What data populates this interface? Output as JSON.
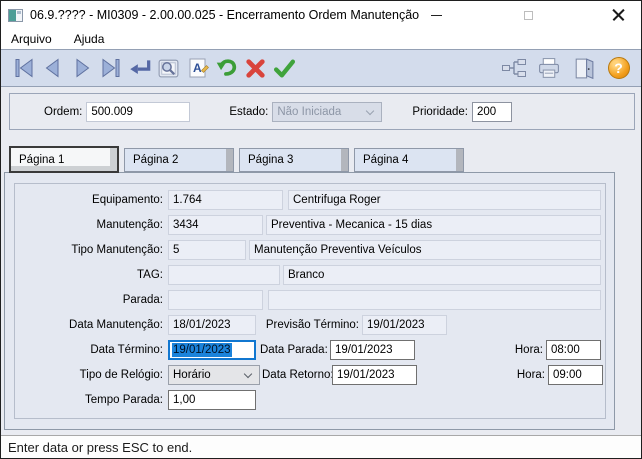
{
  "window": {
    "title": "06.9.???? - MI0309 - 2.00.00.025 - Encerramento Ordem Manutenção"
  },
  "menu": {
    "items": [
      "Arquivo",
      "Ajuda"
    ]
  },
  "toolbar": {
    "left_icons": [
      "nav-first",
      "nav-prev",
      "nav-next",
      "nav-last",
      "enter",
      "preview",
      "font",
      "undo",
      "cancel",
      "confirm"
    ],
    "right_icons": [
      "hierarchy",
      "print",
      "exit",
      "help"
    ]
  },
  "icons": {
    "help_glyph": "?"
  },
  "header": {
    "ordem": {
      "label": "Ordem:",
      "value": "500.009"
    },
    "estado": {
      "label": "Estado:",
      "value": "Não Iniciada"
    },
    "prioridade": {
      "label": "Prioridade:",
      "value": "200"
    }
  },
  "tabs": [
    {
      "label": "Página 1",
      "active": true
    },
    {
      "label": "Página 2",
      "active": false
    },
    {
      "label": "Página 3",
      "active": false
    },
    {
      "label": "Página 4",
      "active": false
    }
  ],
  "form": {
    "equipamento": {
      "label": "Equipamento:",
      "code": "1.764",
      "desc": "Centrifuga Roger"
    },
    "manutencao": {
      "label": "Manutenção:",
      "code": "3434",
      "desc": "Preventiva - Mecanica - 15 dias"
    },
    "tipo_manutencao": {
      "label": "Tipo Manutenção:",
      "code": "5",
      "desc": "Manutenção Preventiva Veículos"
    },
    "tag": {
      "label": "TAG:",
      "code": "",
      "desc": "Branco"
    },
    "parada": {
      "label": "Parada:",
      "code": "",
      "desc": ""
    },
    "data_manutencao": {
      "label": "Data Manutenção:",
      "value": "18/01/2023"
    },
    "previsao_termino": {
      "label": "Previsão Término:",
      "value": "19/01/2023"
    },
    "data_termino": {
      "label": "Data Término:",
      "value": "19/01/2023"
    },
    "data_parada": {
      "label": "Data Parada:",
      "value": "19/01/2023"
    },
    "hora_parada": {
      "label": "Hora:",
      "value": "08:00"
    },
    "tipo_relogio": {
      "label": "Tipo de Relógio:",
      "value": "Horário"
    },
    "data_retorno": {
      "label": "Data Retorno:",
      "value": "19/01/2023"
    },
    "hora_retorno": {
      "label": "Hora:",
      "value": "09:00"
    },
    "tempo_parada": {
      "label": "Tempo Parada:",
      "value": "1,00"
    }
  },
  "statusbar": {
    "message": "Enter data or press ESC to end."
  },
  "colors": {
    "toolbar_bg": "#d3dcec",
    "selection_blue": "#1b83db",
    "focus_border": "#1177d0",
    "confirm_green": "#3fa33c",
    "cancel_red": "#d9443c",
    "help_orange": "#f3a01f",
    "tab_inactive": "#dce4f2",
    "field_disabled": "#ebeef6"
  }
}
